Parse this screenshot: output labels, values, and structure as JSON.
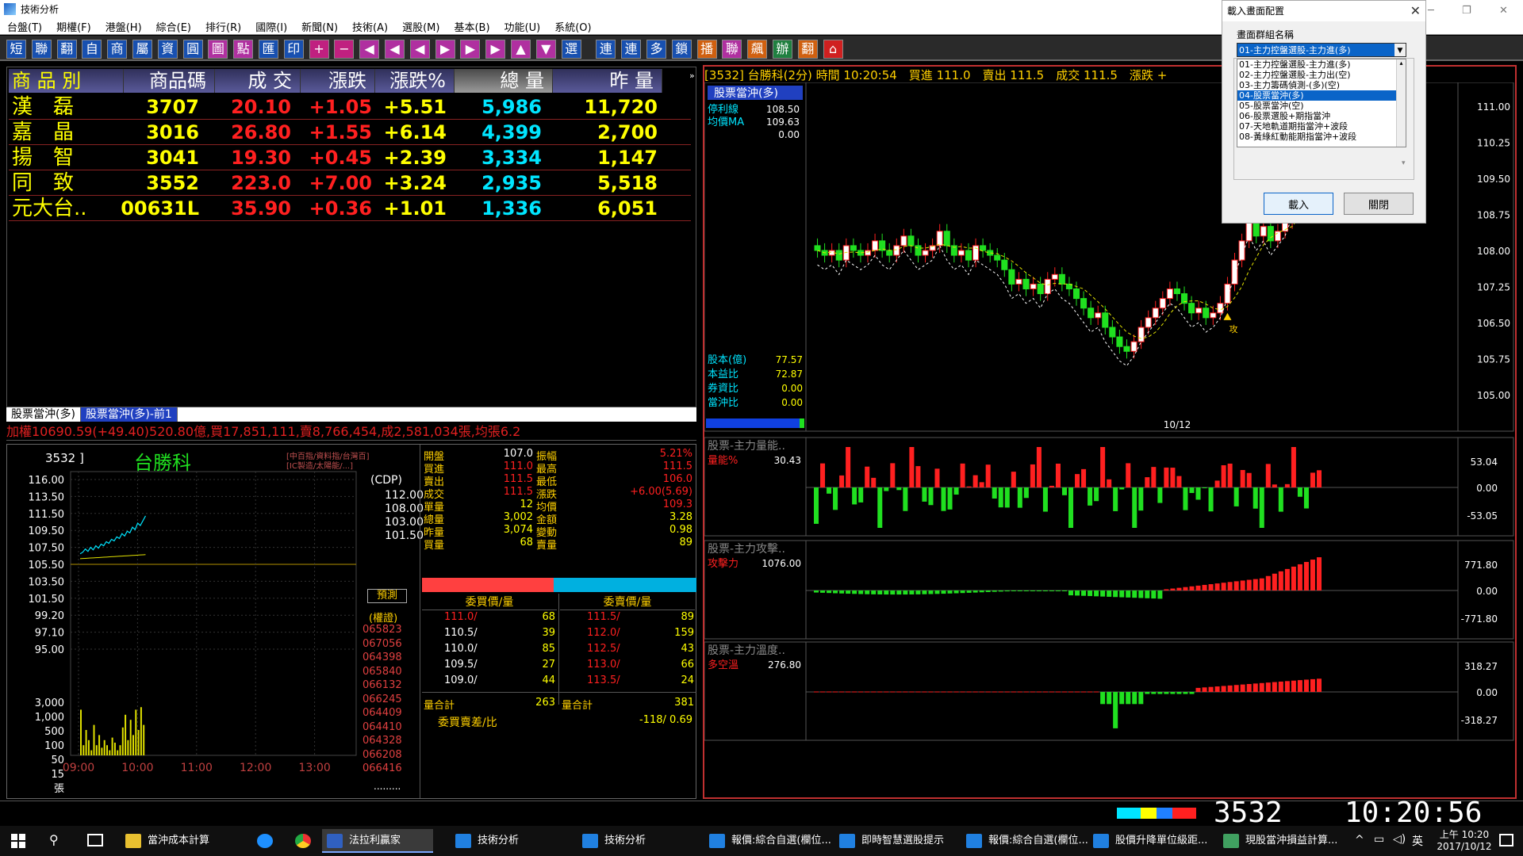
{
  "window": {
    "title": "技術分析"
  },
  "menu": [
    "台盤(T)",
    "期權(F)",
    "港盤(H)",
    "綜合(E)",
    "排行(R)",
    "國際(I)",
    "新聞(N)",
    "技術(A)",
    "選股(M)",
    "基本(B)",
    "功能(U)",
    "系統(O)"
  ],
  "toolbar": [
    "短",
    "聯",
    "翻",
    "自",
    "商",
    "屬",
    "資",
    "圓",
    "圖",
    "點",
    "匯",
    "印",
    "+",
    "−",
    "◀",
    "◀",
    "◀",
    "▶",
    "▶",
    "▶",
    "▲",
    "▼",
    "選",
    "連",
    "連",
    "多",
    "鎖",
    "播",
    "聯",
    "飆",
    "辦",
    "翻",
    "⌂"
  ],
  "quote_table": {
    "headers": [
      "商 品 別",
      "商品碼",
      "成 交",
      "漲跌",
      "漲跌%",
      "總 量",
      "昨 量"
    ],
    "rows": [
      {
        "name": "漢　磊",
        "code": "3707",
        "price": "20.10",
        "chg": "+1.05",
        "pct": "+5.51",
        "vol": "5,986",
        "yvol": "11,720"
      },
      {
        "name": "嘉　晶",
        "code": "3016",
        "price": "26.80",
        "chg": "+1.55",
        "pct": "+6.14",
        "vol": "4,399",
        "yvol": "2,700"
      },
      {
        "name": "揚　智",
        "code": "3041",
        "price": "19.30",
        "chg": "+0.45",
        "pct": "+2.39",
        "vol": "3,334",
        "yvol": "1,147"
      },
      {
        "name": "同　致",
        "code": "3552",
        "price": "223.0",
        "chg": "+7.00",
        "pct": "+3.24",
        "vol": "2,935",
        "yvol": "5,518"
      },
      {
        "name": "元大台..",
        "code": "00631L",
        "price": "35.90",
        "chg": "+0.36",
        "pct": "+1.01",
        "vol": "1,336",
        "yvol": "6,051"
      }
    ],
    "tabs": [
      "股票當沖(多)",
      "股票當沖(多)-前1"
    ]
  },
  "ticker": "加權10690.59(+49.40)520.80億,買17,851,111,賣8,766,454,成2,581,034張,均張6.2",
  "stock": {
    "code": "3532",
    "name": "台勝科",
    "note1": "[中百指/資料指/台灣百]",
    "note2": "[IC製造/太陽能/...]",
    "cdp_label": "(CDP)",
    "cdp_values": [
      "112.00",
      "108.00",
      "103.00",
      "101.50"
    ],
    "predict_label": "預測",
    "warrant_label": "(權證)",
    "warrants": [
      "065823",
      "067056",
      "064398",
      "065840",
      "066132",
      "066245",
      "064409",
      "064410",
      "064328",
      "066208",
      "066416"
    ],
    "price_axis": [
      "116.00",
      "113.50",
      "111.50",
      "109.50",
      "107.50",
      "105.50",
      "103.50",
      "101.50",
      "99.20",
      "97.10",
      "95.00"
    ],
    "vol_axis": [
      "3,000",
      "1,000",
      "500",
      "100",
      "50",
      "15",
      "張"
    ],
    "time_axis": [
      "09:00",
      "10:00",
      "11:00",
      "12:00",
      "13:00"
    ],
    "more_dots": ".........",
    "quote_labels": [
      [
        "開盤",
        "107.0",
        "振幅",
        "5.21%"
      ],
      [
        "買進",
        "111.0",
        "最高",
        "111.5"
      ],
      [
        "賣出",
        "111.5",
        "最低",
        "106.0"
      ],
      [
        "成交",
        "111.5",
        "漲跌",
        "+6.00(5.69)"
      ],
      [
        "單量",
        "12",
        "均價",
        "109.3"
      ],
      [
        "總量",
        "3,002",
        "金額",
        "3.28"
      ],
      [
        "昨量",
        "3,074",
        "變動",
        "0.98"
      ],
      [
        "買量",
        "68",
        "賣量",
        "89"
      ]
    ],
    "bid_header": "委買價/量",
    "ask_header": "委賣價/量",
    "bids": [
      [
        "111.0/",
        "68"
      ],
      [
        "110.5/",
        "39"
      ],
      [
        "110.0/",
        "85"
      ],
      [
        "109.5/",
        "27"
      ],
      [
        "109.0/",
        "44"
      ]
    ],
    "asks": [
      [
        "111.5/",
        "89"
      ],
      [
        "112.0/",
        "159"
      ],
      [
        "112.5/",
        "43"
      ],
      [
        "113.0/",
        "66"
      ],
      [
        "113.5/",
        "24"
      ]
    ],
    "bid_total_label": "量合計",
    "bid_total": "263",
    "ask_total_label": "量合計",
    "ask_total": "381",
    "diff_label": "委買賣差/比",
    "diff_value": "-118/ 0.69",
    "bid_ratio": 0.48
  },
  "right": {
    "header": "[3532] 台勝科(2分) 時間 10:20:54　買進 111.0　賣出 111.5　成交 111.5　漲跌 +",
    "panel_tag": "股票當沖(多)",
    "side_labels": [
      [
        "停利線",
        "108.50"
      ],
      [
        "均價MA",
        "109.63"
      ],
      [
        "",
        "0.00"
      ]
    ],
    "fund_labels": [
      [
        "股本(億)",
        "77.57"
      ],
      [
        "本益比",
        "72.87"
      ],
      [
        "券資比",
        "0.00"
      ],
      [
        "當沖比",
        "0.00"
      ]
    ],
    "price_axis": [
      "111.00",
      "110.25",
      "109.50",
      "108.75",
      "108.00",
      "107.25",
      "106.50",
      "105.75",
      "105.00"
    ],
    "date_label": "10/12",
    "marker_label": "攻",
    "ind1": {
      "title": "股票-主力量能..",
      "label": "量能%",
      "value": "30.43",
      "axis": [
        "53.04",
        "0.00",
        "-53.05"
      ]
    },
    "ind2": {
      "title": "股票-主力攻擊..",
      "label": "攻擊力",
      "value": "1076.00",
      "axis": [
        "771.80",
        "0.00",
        "-771.80"
      ]
    },
    "ind3": {
      "title": "股票-主力溫度..",
      "label": "多空溫",
      "value": "276.80",
      "axis": [
        "318.27",
        "0.00",
        "-318.27"
      ]
    }
  },
  "dialog": {
    "title": "載入畫面配置",
    "group_label": "畫面群組名稱",
    "selected": "01-主力控盤選股-主力進(多)",
    "options": [
      "01-主力控盤選股-主力進(多)",
      "02-主力控盤選股-主力出(空)",
      "03-主力籌碼偵測-(多)(空)",
      "04-股票當沖(多)",
      "05-股票當沖(空)",
      "06-股票選股+期指當沖",
      "07-天地軌道期指當沖+波段",
      "08-黃綠紅動能期指當沖+波段"
    ],
    "load_button": "載入",
    "close_button": "關閉"
  },
  "status": {
    "code": "3532",
    "time": "10:20:56"
  },
  "taskbar": {
    "items": [
      "當沖成本計算",
      "法拉利贏家",
      "技術分析",
      "技術分析",
      "報價:綜合自選(欄位...",
      "即時智慧選股提示",
      "報價:綜合自選(欄位...",
      "股價升降單位級距...",
      "現股當沖損益計算..."
    ],
    "ime": "英",
    "clock_time": "上午 10:20",
    "clock_date": "2017/10/12"
  },
  "colors": {
    "up": "#ff2020",
    "down": "#20e020",
    "text_yellow": "#ffff00",
    "cyan": "#00e5ff"
  }
}
